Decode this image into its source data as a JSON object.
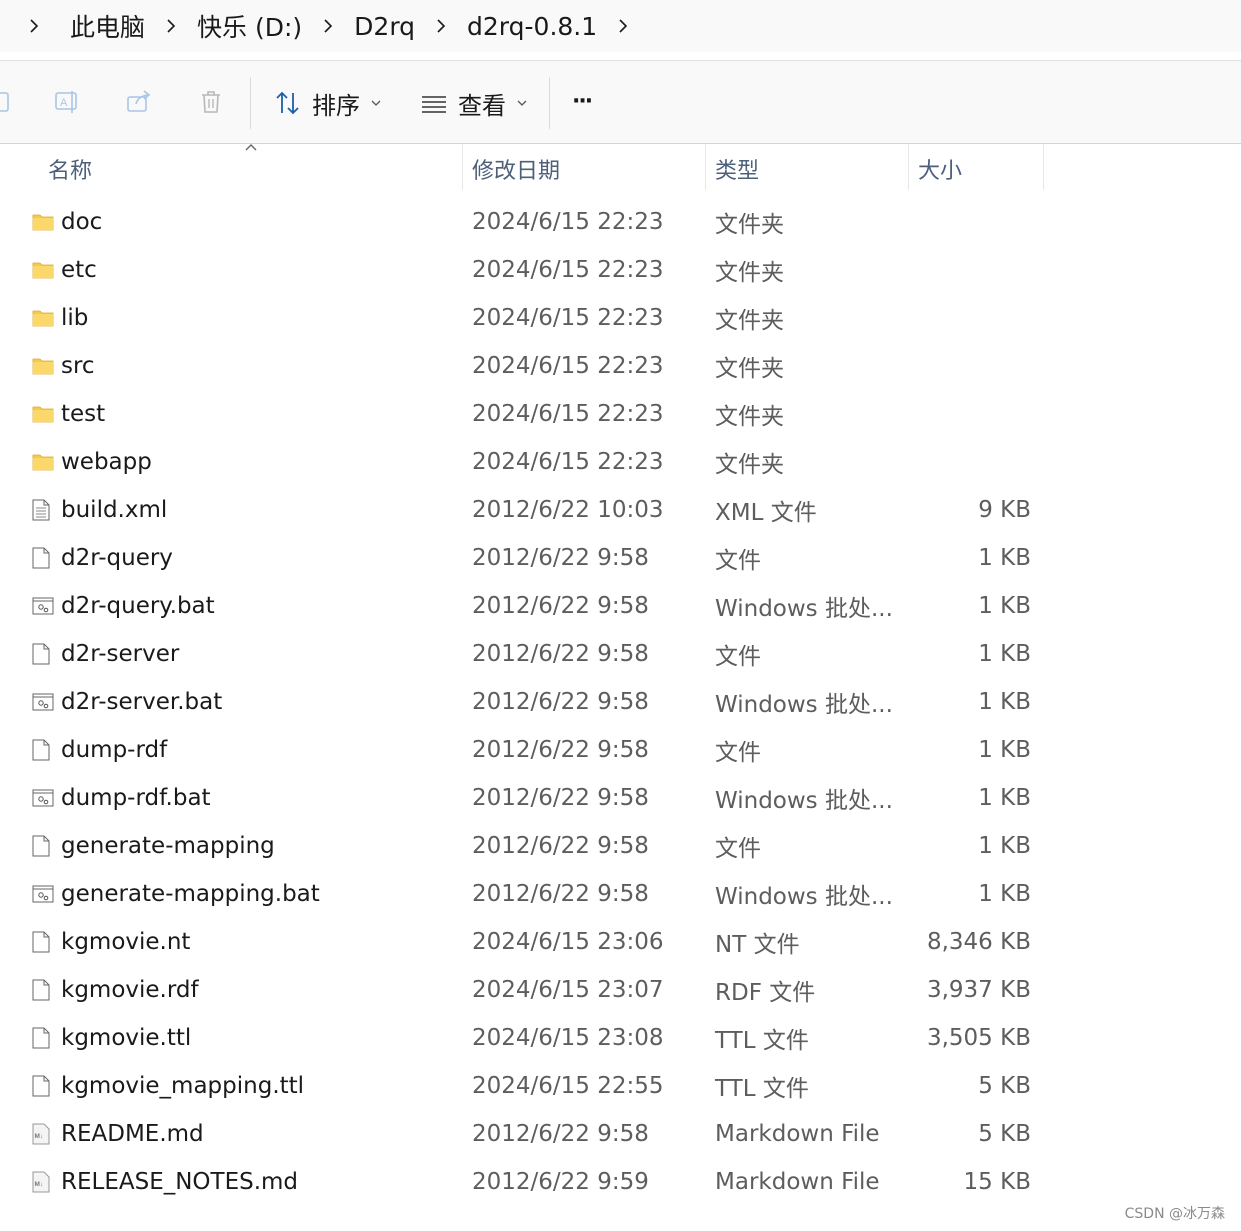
{
  "breadcrumb": {
    "items": [
      "此电脑",
      "快乐 (D:)",
      "D2rq",
      "d2rq-0.8.1"
    ]
  },
  "toolbar": {
    "sort_label": "排序",
    "view_label": "查看",
    "more_label": "···"
  },
  "columns": {
    "name": "名称",
    "date": "修改日期",
    "type": "类型",
    "size": "大小"
  },
  "files": [
    {
      "icon": "folder-icon",
      "name": "doc",
      "date": "2024/6/15 22:23",
      "type": "文件夹",
      "size": ""
    },
    {
      "icon": "folder-icon",
      "name": "etc",
      "date": "2024/6/15 22:23",
      "type": "文件夹",
      "size": ""
    },
    {
      "icon": "folder-icon",
      "name": "lib",
      "date": "2024/6/15 22:23",
      "type": "文件夹",
      "size": ""
    },
    {
      "icon": "folder-icon",
      "name": "src",
      "date": "2024/6/15 22:23",
      "type": "文件夹",
      "size": ""
    },
    {
      "icon": "folder-icon",
      "name": "test",
      "date": "2024/6/15 22:23",
      "type": "文件夹",
      "size": ""
    },
    {
      "icon": "folder-icon",
      "name": "webapp",
      "date": "2024/6/15 22:23",
      "type": "文件夹",
      "size": ""
    },
    {
      "icon": "xml-file-icon",
      "name": "build.xml",
      "date": "2012/6/22 10:03",
      "type": "XML 文件",
      "size": "9 KB"
    },
    {
      "icon": "file-icon",
      "name": "d2r-query",
      "date": "2012/6/22 9:58",
      "type": "文件",
      "size": "1 KB"
    },
    {
      "icon": "batch-file-icon",
      "name": "d2r-query.bat",
      "date": "2012/6/22 9:58",
      "type": "Windows 批处...",
      "size": "1 KB"
    },
    {
      "icon": "file-icon",
      "name": "d2r-server",
      "date": "2012/6/22 9:58",
      "type": "文件",
      "size": "1 KB"
    },
    {
      "icon": "batch-file-icon",
      "name": "d2r-server.bat",
      "date": "2012/6/22 9:58",
      "type": "Windows 批处...",
      "size": "1 KB"
    },
    {
      "icon": "file-icon",
      "name": "dump-rdf",
      "date": "2012/6/22 9:58",
      "type": "文件",
      "size": "1 KB"
    },
    {
      "icon": "batch-file-icon",
      "name": "dump-rdf.bat",
      "date": "2012/6/22 9:58",
      "type": "Windows 批处...",
      "size": "1 KB"
    },
    {
      "icon": "file-icon",
      "name": "generate-mapping",
      "date": "2012/6/22 9:58",
      "type": "文件",
      "size": "1 KB"
    },
    {
      "icon": "batch-file-icon",
      "name": "generate-mapping.bat",
      "date": "2012/6/22 9:58",
      "type": "Windows 批处...",
      "size": "1 KB"
    },
    {
      "icon": "file-icon",
      "name": "kgmovie.nt",
      "date": "2024/6/15 23:06",
      "type": "NT 文件",
      "size": "8,346 KB"
    },
    {
      "icon": "file-icon",
      "name": "kgmovie.rdf",
      "date": "2024/6/15 23:07",
      "type": "RDF 文件",
      "size": "3,937 KB"
    },
    {
      "icon": "file-icon",
      "name": "kgmovie.ttl",
      "date": "2024/6/15 23:08",
      "type": "TTL 文件",
      "size": "3,505 KB"
    },
    {
      "icon": "file-icon",
      "name": "kgmovie_mapping.ttl",
      "date": "2024/6/15 22:55",
      "type": "TTL 文件",
      "size": "5 KB"
    },
    {
      "icon": "markdown-file-icon",
      "name": "README.md",
      "date": "2012/6/22 9:58",
      "type": "Markdown File",
      "size": "5 KB"
    },
    {
      "icon": "markdown-file-icon",
      "name": "RELEASE_NOTES.md",
      "date": "2012/6/22 9:59",
      "type": "Markdown File",
      "size": "15 KB"
    }
  ],
  "watermark": "CSDN @冰万森"
}
